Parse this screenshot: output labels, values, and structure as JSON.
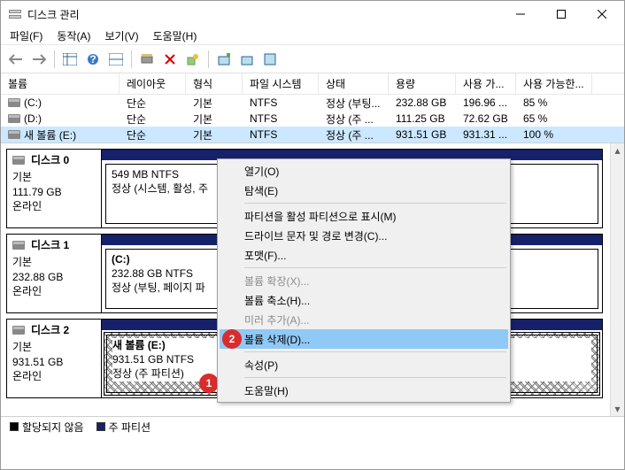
{
  "window": {
    "title": "디스크 관리"
  },
  "menu": {
    "file": "파일(F)",
    "action": "동작(A)",
    "view": "보기(V)",
    "help": "도움말(H)"
  },
  "columns": {
    "vol": "볼륨",
    "layout": "레이아웃",
    "fmt": "형식",
    "fs": "파일 시스템",
    "status": "상태",
    "cap": "용량",
    "free": "사용 가...",
    "pct": "사용 가능한..."
  },
  "volumes": [
    {
      "name": "(C:)",
      "layout": "단순",
      "fmt": "기본",
      "fs": "NTFS",
      "status": "정상 (부팅...",
      "cap": "232.88 GB",
      "free": "196.96 ...",
      "pct": "85 %",
      "selected": false
    },
    {
      "name": "(D:)",
      "layout": "단순",
      "fmt": "기본",
      "fs": "NTFS",
      "status": "정상 (주 ...",
      "cap": "111.25 GB",
      "free": "72.62 GB",
      "pct": "65 %",
      "selected": false
    },
    {
      "name": "새 볼륨 (E:)",
      "layout": "단순",
      "fmt": "기본",
      "fs": "NTFS",
      "status": "정상 (주 ...",
      "cap": "931.51 GB",
      "free": "931.31 ...",
      "pct": "100 %",
      "selected": true
    }
  ],
  "disks": [
    {
      "title": "디스크 0",
      "type": "기본",
      "size": "111.79 GB",
      "state": "온라인",
      "part": {
        "header": "",
        "line1": "549 MB NTFS",
        "line2": "정상 (시스템, 활성, 주"
      }
    },
    {
      "title": "디스크 1",
      "type": "기본",
      "size": "232.88 GB",
      "state": "온라인",
      "part": {
        "header": "(C:)",
        "line1": "232.88 GB NTFS",
        "line2": "정상 (부팅, 페이지 파"
      }
    },
    {
      "title": "디스크 2",
      "type": "기본",
      "size": "931.51 GB",
      "state": "온라인",
      "part": {
        "header": "새 볼륨  (E:)",
        "line1": "931.51 GB NTFS",
        "line2": "정상 (주 파티션)"
      }
    }
  ],
  "legend": {
    "unalloc": "할당되지 않음",
    "primary": "주 파티션"
  },
  "context": {
    "open": "열기(O)",
    "explore": "탐색(E)",
    "mark_active": "파티션을 활성 파티션으로 표시(M)",
    "change_letter": "드라이브 문자 및 경로 변경(C)...",
    "format": "포맷(F)...",
    "extend": "볼륨 확장(X)...",
    "shrink": "볼륨 축소(H)...",
    "mirror": "미러 추가(A)...",
    "delete": "볼륨 삭제(D)...",
    "props": "속성(P)",
    "help": "도움말(H)"
  },
  "badges": {
    "one": "1",
    "two": "2"
  }
}
